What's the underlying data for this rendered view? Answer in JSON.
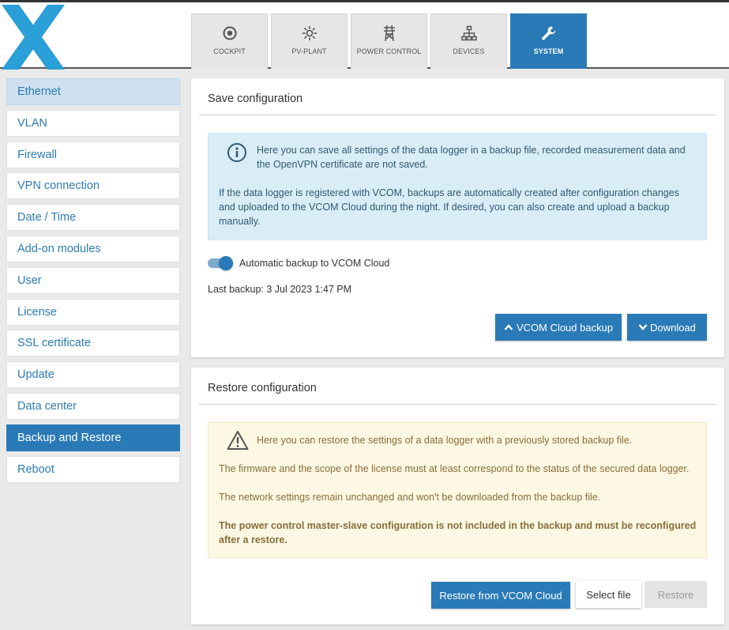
{
  "header": {
    "tabs": [
      {
        "label": "COCKPIT",
        "icon": "target-icon"
      },
      {
        "label": "PV-PLANT",
        "icon": "sun-icon"
      },
      {
        "label": "POWER CONTROL",
        "icon": "power-tower-icon"
      },
      {
        "label": "DEVICES",
        "icon": "network-icon"
      },
      {
        "label": "SYSTEM",
        "icon": "wrench-icon",
        "active": true
      }
    ]
  },
  "sidebar": {
    "items": [
      {
        "label": "Ethernet"
      },
      {
        "label": "VLAN"
      },
      {
        "label": "Firewall"
      },
      {
        "label": "VPN connection"
      },
      {
        "label": "Date / Time"
      },
      {
        "label": "Add-on modules"
      },
      {
        "label": "User"
      },
      {
        "label": "License"
      },
      {
        "label": "SSL certificate"
      },
      {
        "label": "Update"
      },
      {
        "label": "Data center"
      },
      {
        "label": "Backup and Restore",
        "active": true
      },
      {
        "label": "Reboot"
      }
    ]
  },
  "save": {
    "title": "Save configuration",
    "info_line1": "Here you can save all settings of the data logger in a backup file, recorded measurement data and",
    "info_line2": "the OpenVPN certificate are not saved.",
    "info_para2": "If the data logger is registered with VCOM, backups are automatically created after configuration changes and uploaded to the VCOM Cloud during the night. If desired, you can also create and upload a backup manually.",
    "toggle_label": "Automatic backup to VCOM Cloud",
    "last_backup": "Last backup: 3 Jul 2023 1:47 PM",
    "cloud_backup_label": "VCOM Cloud backup",
    "download_label": "Download"
  },
  "restore": {
    "title": "Restore configuration",
    "warn_line1": "Here you can restore the settings of a data logger with a previously stored backup file.",
    "warn_para2": "The firmware and the scope of the license must at least correspond to the status of the secured data logger.",
    "warn_para3": "The network settings remain unchanged and won't be downloaded from the backup file.",
    "warn_para4": "The power control master-slave configuration is not included in the backup and must be reconfigured after a restore.",
    "restore_cloud_label": "Restore from VCOM Cloud",
    "select_file_label": "Select file",
    "restore_label": "Restore"
  },
  "colors": {
    "accent": "#2a7ab7",
    "info_bg": "#d9edf7",
    "warn_bg": "#fcf8e3",
    "logo": "#2a9fd8"
  }
}
